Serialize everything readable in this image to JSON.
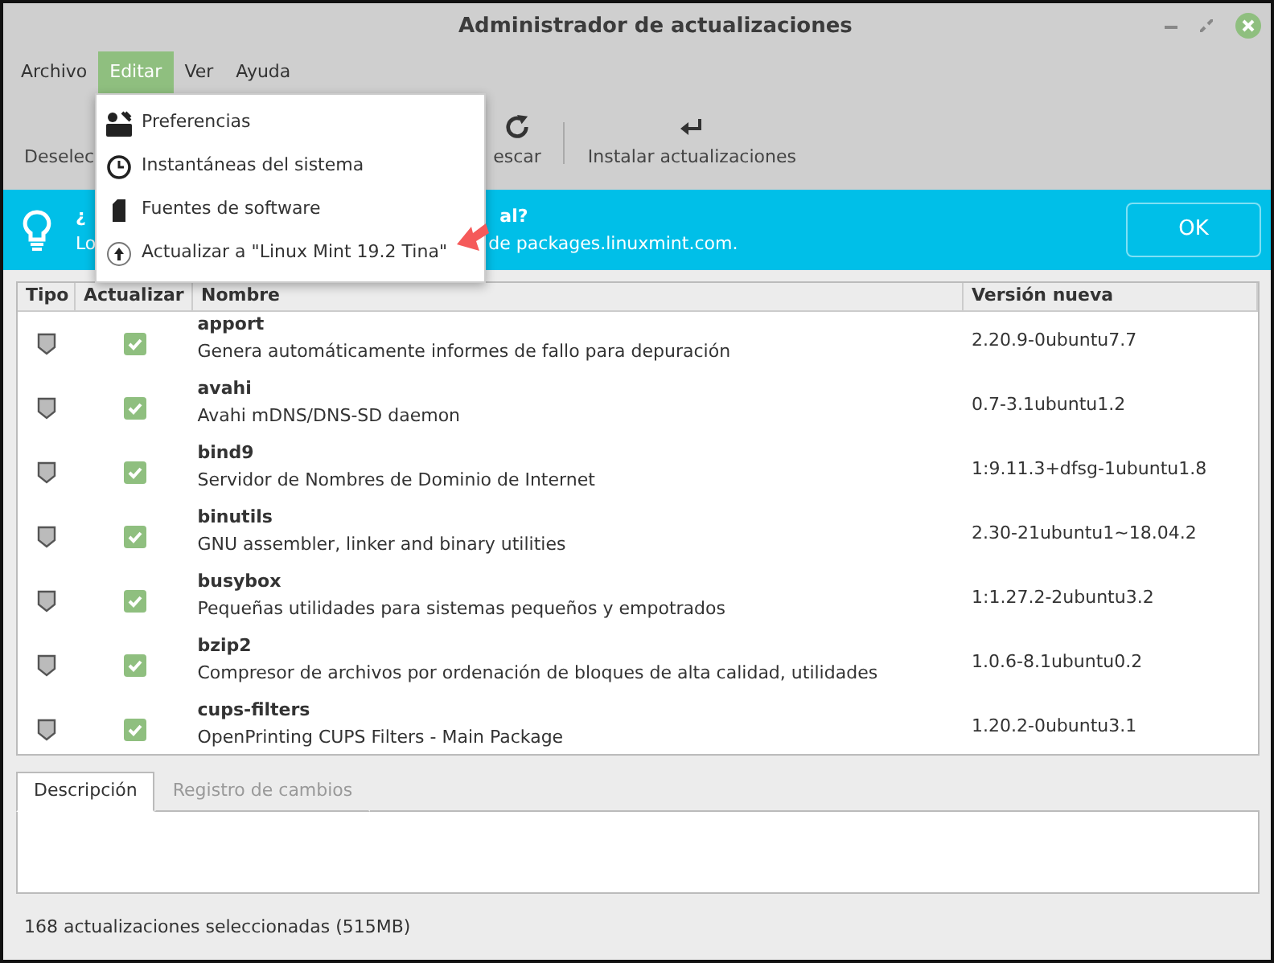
{
  "window": {
    "title": "Administrador de actualizaciones"
  },
  "menubar": [
    {
      "label": "Archivo",
      "selected": false
    },
    {
      "label": "Editar",
      "selected": true
    },
    {
      "label": "Ver",
      "selected": false
    },
    {
      "label": "Ayuda",
      "selected": false
    }
  ],
  "menu": {
    "items": [
      {
        "label": "Preferencias"
      },
      {
        "label": "Instantáneas del sistema"
      },
      {
        "label": "Fuentes de software"
      },
      {
        "label": "Actualizar a \"Linux Mint 19.2 Tina\""
      }
    ]
  },
  "toolbar": [
    {
      "label": "Deselec"
    },
    {
      "label": "escar"
    },
    {
      "label": "Instalar actualizaciones"
    }
  ],
  "banner": {
    "title_start": "¿",
    "title_end": "al?",
    "text_start": "Lo",
    "text_end": "de packages.linuxmint.com.",
    "button": "OK"
  },
  "table": {
    "columns": [
      "Tipo",
      "Actualizar",
      "Nombre",
      "Versión nueva"
    ],
    "rows": [
      {
        "name": "apport",
        "description": "Genera automáticamente informes de fallo para depuración",
        "version": "2.20.9-0ubuntu7.7",
        "checked": true
      },
      {
        "name": "avahi",
        "description": "Avahi mDNS/DNS-SD daemon",
        "version": "0.7-3.1ubuntu1.2",
        "checked": true
      },
      {
        "name": "bind9",
        "description": "Servidor de Nombres de Dominio de Internet",
        "version": "1:9.11.3+dfsg-1ubuntu1.8",
        "checked": true
      },
      {
        "name": "binutils",
        "description": "GNU assembler, linker and binary utilities",
        "version": "2.30-21ubuntu1~18.04.2",
        "checked": true
      },
      {
        "name": "busybox",
        "description": "Pequeñas utilidades para sistemas pequeños y empotrados",
        "version": "1:1.27.2-2ubuntu3.2",
        "checked": true
      },
      {
        "name": "bzip2",
        "description": "Compresor de archivos por ordenación de bloques de alta calidad, utilidades",
        "version": "1.0.6-8.1ubuntu0.2",
        "checked": true
      },
      {
        "name": "cups-filters",
        "description": "OpenPrinting CUPS Filters - Main Package",
        "version": "1.20.2-0ubuntu3.1",
        "checked": true
      }
    ]
  },
  "details": {
    "tabs": [
      {
        "label": "Descripción",
        "selected": true
      },
      {
        "label": "Registro de cambios",
        "selected": false
      }
    ]
  },
  "status_bar": "168 actualizaciones seleccionadas (515MB)"
}
